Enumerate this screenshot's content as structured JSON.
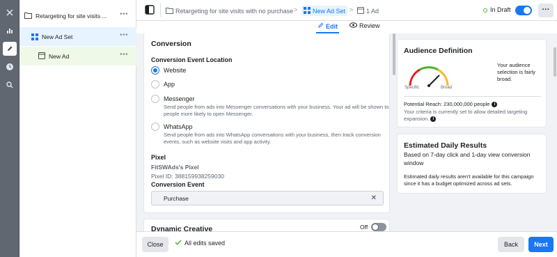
{
  "sidebar_rail": {
    "icons": [
      "close-icon",
      "chart-icon",
      "pencil-icon",
      "clock-icon",
      "search-icon"
    ]
  },
  "tree": {
    "items": [
      {
        "label": "Retargeting for site visits ...",
        "icon": "folder-icon"
      },
      {
        "label": "New Ad Set",
        "icon": "grid-icon"
      },
      {
        "label": "New Ad",
        "icon": "ad-icon"
      }
    ],
    "more": "•••"
  },
  "topbar": {
    "crumb_campaign": "Retargeting for site visits with no purchase",
    "crumb_adset": "New Ad Set",
    "crumb_ad": "1 Ad",
    "sep": ">",
    "status_label": "In Draft",
    "more": "···"
  },
  "tabs": {
    "edit": "Edit",
    "review": "Review"
  },
  "conversion": {
    "title": "Conversion",
    "location_label": "Conversion Event Location",
    "options": [
      {
        "label": "Website",
        "desc": ""
      },
      {
        "label": "App",
        "desc": ""
      },
      {
        "label": "Messenger",
        "desc": "Send people from ads into Messenger conversations with your business. Your ad will be shown to people more likely to open Messenger."
      },
      {
        "label": "WhatsApp",
        "desc": "Send people from ads into WhatsApp conversations with your business, then track conversion events, such as website visits and app activity."
      }
    ],
    "pixel_label": "Pixel",
    "pixel_name": "FitSWAds's Pixel",
    "pixel_id": "Pixel ID: 388159938259030",
    "event_label": "Conversion Event",
    "event_value": "Purchase",
    "clear": "✕"
  },
  "dynamic_creative": {
    "title": "Dynamic Creative",
    "toggle_label": "Off"
  },
  "audience": {
    "title": "Audience Definition",
    "gauge_specific": "Specific",
    "gauge_broad": "Broad",
    "summary": "Your audience selection is fairly broad.",
    "reach": "Potential Reach: 230,000,000 people",
    "criteria": "Your criteria is currently set to allow detailed targeting expansion."
  },
  "estimated": {
    "title": "Estimated Daily Results",
    "subtitle": "Based on 7-day click and 1-day view conversion window",
    "note": "Estimated daily results aren't available for this campaign since it has a budget optimized across ad sets."
  },
  "bottombar": {
    "close": "Close",
    "saved": "All edits saved",
    "back": "Back",
    "next": "Next"
  },
  "colors": {
    "accent": "#1877f2",
    "status_green": "#42b72a"
  }
}
